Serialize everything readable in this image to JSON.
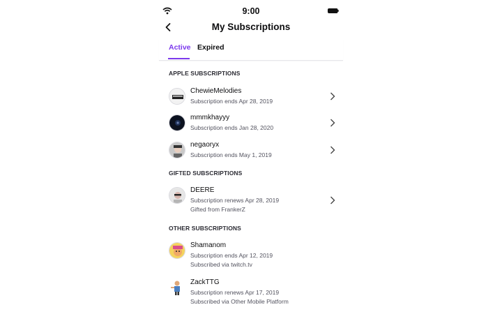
{
  "status_bar": {
    "time": "9:00"
  },
  "header": {
    "title": "My Subscriptions"
  },
  "tabs": [
    {
      "label": "Active"
    },
    {
      "label": "Expired"
    }
  ],
  "sections": [
    {
      "title": "APPLE SUBSCRIPTIONS",
      "items": [
        {
          "name": "ChewieMelodies",
          "line1": "Subscription ends Apr 28, 2019"
        },
        {
          "name": "mmmkhayyy",
          "line1": "Subscription ends Jan 28, 2020"
        },
        {
          "name": "negaoryx",
          "line1": "Subscription ends May 1, 2019"
        }
      ]
    },
    {
      "title": "GIFTED SUBSCRIPTIONS",
      "items": [
        {
          "name": "DEERE",
          "line1": "Subscription renews Apr 28, 2019",
          "line2": "Gifted from FrankerZ"
        }
      ]
    },
    {
      "title": "OTHER SUBSCRIPTIONS",
      "items": [
        {
          "name": "Shamanom",
          "line1": "Subscription ends Apr 12, 2019",
          "line2": "Subscribed via twitch.tv"
        },
        {
          "name": "ZackTTG",
          "line1": "Subscription renews Apr 17, 2019",
          "line2": "Subscribed via Other Mobile Platform"
        }
      ]
    }
  ],
  "colors": {
    "accent": "#7c3aed",
    "text": "#0e0e10",
    "secondary_text": "#53535f"
  }
}
